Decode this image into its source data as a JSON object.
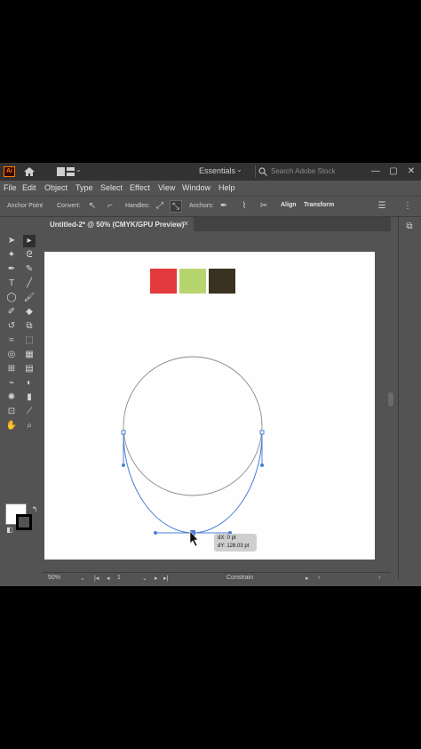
{
  "app": {
    "logo": "Ai",
    "workspace": "Essentials",
    "search_placeholder": "Search Adobe Stock",
    "window_controls": [
      "—",
      "▢",
      "✕"
    ]
  },
  "menu": [
    "File",
    "Edit",
    "Object",
    "Type",
    "Select",
    "Effect",
    "View",
    "Window",
    "Help"
  ],
  "control_bar": {
    "context": "Anchor Point",
    "convert": "Convert:",
    "handles": "Handles:",
    "anchors": "Anchors:",
    "align": "Align",
    "transform": "Transform"
  },
  "document": {
    "tab_title": "Untitled-2* @ 50% (CMYK/GPU Preview)",
    "close": "✕"
  },
  "swatches": [
    {
      "color": "#e23a3c"
    },
    {
      "color": "#b7d56e"
    },
    {
      "color": "#3b3121"
    }
  ],
  "tooltip": {
    "dx": "dX: 0 pt",
    "dy": "dY: 128.03 pt"
  },
  "status": {
    "zoom": "50%",
    "artboard": "1",
    "mode": "Constrain"
  },
  "colors": {
    "path": "#4a7fd6",
    "ui_bg": "#535353",
    "title_bg": "#323232"
  }
}
